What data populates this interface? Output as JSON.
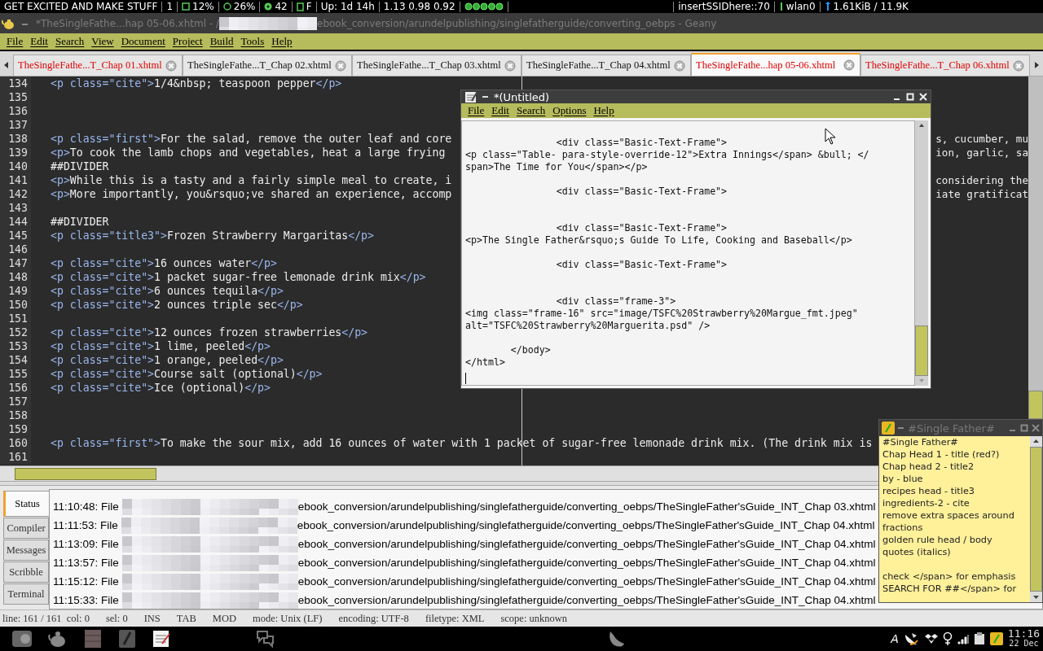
{
  "top_panel": {
    "left": [
      {
        "kind": "plain",
        "text": "GET EXCITED AND MAKE STUFF"
      },
      {
        "kind": "plain",
        "text": "1"
      },
      {
        "kind": "chip",
        "text": "12%"
      },
      {
        "kind": "gauge",
        "text": "26%"
      },
      {
        "kind": "disk",
        "text": "42"
      },
      {
        "kind": "doc",
        "text": "F"
      },
      {
        "kind": "plain",
        "text": "Up: 1d 14h"
      },
      {
        "kind": "plain",
        "text": "1.13 0.98 0.92"
      },
      {
        "kind": "indicators"
      }
    ],
    "right": [
      {
        "kind": "plain",
        "text": "insertSSIDhere::70"
      },
      {
        "kind": "signal",
        "text": "wlan0"
      },
      {
        "kind": "network",
        "text": "1.61KiB / 11.9K"
      }
    ]
  },
  "window": {
    "title_start": "*TheSingleFathe...hap 05-06.xhtml - /",
    "title_end": "ebook_conversion/arundelpublishing/singlefatherguide/converting_oebps - Geany"
  },
  "menu": [
    "File",
    "Edit",
    "Search",
    "View",
    "Document",
    "Project",
    "Build",
    "Tools",
    "Help"
  ],
  "tabs": [
    {
      "label": "TheSingleFathe...T_Chap 01.xhtml",
      "selected": false,
      "modified": true
    },
    {
      "label": "TheSingleFathe...T_Chap 02.xhtml",
      "selected": false,
      "modified": false
    },
    {
      "label": "TheSingleFathe...T_Chap 03.xhtml",
      "selected": false,
      "modified": false
    },
    {
      "label": "TheSingleFathe...T_Chap 04.xhtml",
      "selected": false,
      "modified": false
    },
    {
      "label": "TheSingleFathe...hap 05-06.xhtml",
      "selected": true,
      "modified": true
    },
    {
      "label": "TheSingleFathe...T_Chap 06.xhtml",
      "selected": false,
      "modified": true
    }
  ],
  "editor": {
    "lines": [
      {
        "number": "134",
        "text": "<p class=\"cite\">1/4&nbsp; teaspoon pepper</p>"
      },
      {
        "number": "135"
      },
      {
        "number": "136"
      },
      {
        "number": "137"
      },
      {
        "number": "138",
        "text": "<p class=\"first\">For the salad, remove the outer leaf and core",
        "end": "s, cucumber, mu"
      },
      {
        "number": "139",
        "text": "<p>To cook the lamb chops and vegetables, heat a large frying",
        "end": "ion, garlic, sa"
      },
      {
        "number": "140",
        "text": "##DIVIDER"
      },
      {
        "number": "141",
        "text": "<p>While this is a tasty and a fairly simple meal to create, i",
        "end": "considering the"
      },
      {
        "number": "142",
        "text": "<p>More importantly, you&rsquo;ve shared an experience, accomp",
        "end": "iate gratificat"
      },
      {
        "number": "143"
      },
      {
        "number": "144",
        "text": "##DIVIDER"
      },
      {
        "number": "145",
        "text": "<p class=\"title3\">Frozen Strawberry Margaritas</p>"
      },
      {
        "number": "146"
      },
      {
        "number": "147",
        "text": "<p class=\"cite\">16 ounces water</p>"
      },
      {
        "number": "148",
        "text": "<p class=\"cite\">1 packet sugar-free lemonade drink mix</p>"
      },
      {
        "number": "149",
        "text": "<p class=\"cite\">6 ounces tequila</p>"
      },
      {
        "number": "150",
        "text": "<p class=\"cite\">2 ounces triple sec</p>"
      },
      {
        "number": "151"
      },
      {
        "number": "152",
        "text": "<p class=\"cite\">12 ounces frozen strawberries</p>"
      },
      {
        "number": "153",
        "text": "<p class=\"cite\">1 lime, peeled</p>"
      },
      {
        "number": "154",
        "text": "<p class=\"cite\">1 orange, peeled</p>"
      },
      {
        "number": "155",
        "text": "<p class=\"cite\">Course salt (optional)</p>"
      },
      {
        "number": "156",
        "text": "<p class=\"cite\">Ice (optional)</p>"
      },
      {
        "number": "157"
      },
      {
        "number": "158"
      },
      {
        "number": "159"
      },
      {
        "number": "160",
        "text": "<p class=\"first\">To make the sour mix, add 16 ounces of water with 1 packet of sugar-free lemonade drink mix. (The drink mix is"
      },
      {
        "number": "161"
      }
    ]
  },
  "message_panel": {
    "tabs": [
      {
        "label": "Status",
        "selected": true
      },
      {
        "label": "Compiler",
        "selected": false
      },
      {
        "label": "Messages",
        "selected": false
      },
      {
        "label": "Scribble",
        "selected": false
      },
      {
        "label": "Terminal",
        "selected": false
      }
    ],
    "log": [
      {
        "time": "11:10:48: File",
        "path": "ebook_conversion/arundelpublishing/singlefatherguide/converting_oebps/TheSingleFather'sGuide_INT_Chap 03.xhtml"
      },
      {
        "time": "11:11:53: File",
        "path": "ebook_conversion/arundelpublishing/singlefatherguide/converting_oebps/TheSingleFather'sGuide_INT_Chap 04.xhtml"
      },
      {
        "time": "11:13:09: File",
        "path": "ebook_conversion/arundelpublishing/singlefatherguide/converting_oebps/TheSingleFather'sGuide_INT_Chap 04.xhtml"
      },
      {
        "time": "11:13:57: File",
        "path": "ebook_conversion/arundelpublishing/singlefatherguide/converting_oebps/TheSingleFather'sGuide_INT_Chap 04.xhtml"
      },
      {
        "time": "11:15:12: File",
        "path": "ebook_conversion/arundelpublishing/singlefatherguide/converting_oebps/TheSingleFather'sGuide_INT_Chap 04.xhtml"
      },
      {
        "time": "11:15:33: File",
        "path": "ebook_conversion/arundelpublishing/singlefatherguide/converting_oebps/TheSingleFather'sGuide_INT_Chap 04.xhtml"
      }
    ]
  },
  "status_bar": [
    "line: 161 / 161  col: 0",
    "sel: 0",
    "INS",
    "TAB",
    "MOD",
    "mode: Unix (LF)",
    "encoding: UTF-8",
    "filetype: XML",
    "scope: unknown"
  ],
  "scratch_window": {
    "title": "*(Untitled)",
    "menu": [
      "File",
      "Edit",
      "Search",
      "Options",
      "Help"
    ],
    "text": "\n                <div class=\"Basic-Text-Frame\">\n<p class=\"Table- para-style-override-12\">Extra Innings</span> &bull; </\nspan>The Time for You</span></p>\n\n                <div class=\"Basic-Text-Frame\">\n\n\n                <div class=\"Basic-Text-Frame\">\n<p>The Single Father&rsquo;s Guide To Life, Cooking and Baseball</p>\n\n                <div class=\"Basic-Text-Frame\">\n\n\n                <div class=\"frame-3\">\n<img class=\"frame-16\" src=\"image/TSFC%20Strawberry%20Margue_fmt.jpeg\"\nalt=\"TSFC%20Strawberry%20Marguerita.psd\" />\n\n        </body>\n</html>"
  },
  "sticky_note": {
    "title": "#Single Father#",
    "text": "#Single Father#\nChap Head 1 - title (red?)\nChap head 2 - title2\nby - blue\nrecipes head - title3\ningredients-2 - cite\nremove extra spaces around\nfractions\ngolden rule head / body\nquotes (italics)\n\ncheck </span> for emphasis\nSEARCH FOR ##</span> for"
  },
  "taskbar": {
    "tray_letter": "A",
    "time": "11:16",
    "date": "22 Dec"
  }
}
